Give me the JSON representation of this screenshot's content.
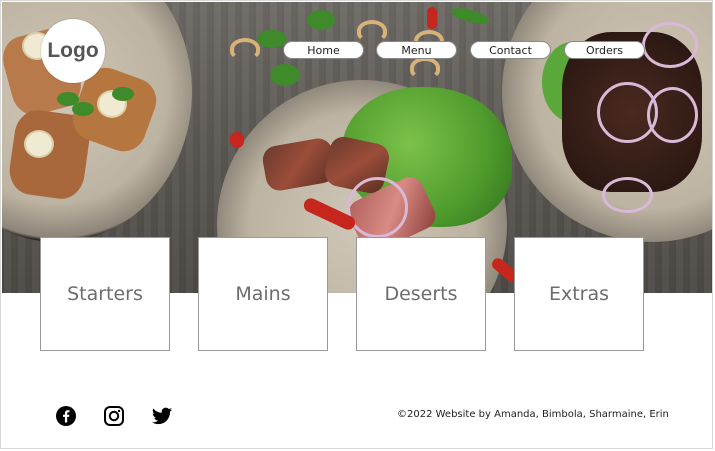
{
  "logo": {
    "text": "Logo"
  },
  "nav": {
    "items": [
      {
        "label": "Home"
      },
      {
        "label": "Menu"
      },
      {
        "label": "Contact"
      },
      {
        "label": "Orders"
      }
    ]
  },
  "categories": [
    {
      "label": "Starters"
    },
    {
      "label": "Mains"
    },
    {
      "label": "Deserts"
    },
    {
      "label": "Extras"
    }
  ],
  "footer": {
    "social": [
      {
        "icon": "facebook-icon"
      },
      {
        "icon": "instagram-icon"
      },
      {
        "icon": "twitter-icon"
      }
    ],
    "copyright": "©2022 Website by Amanda, Bimbola, Sharmaine, Erin"
  }
}
